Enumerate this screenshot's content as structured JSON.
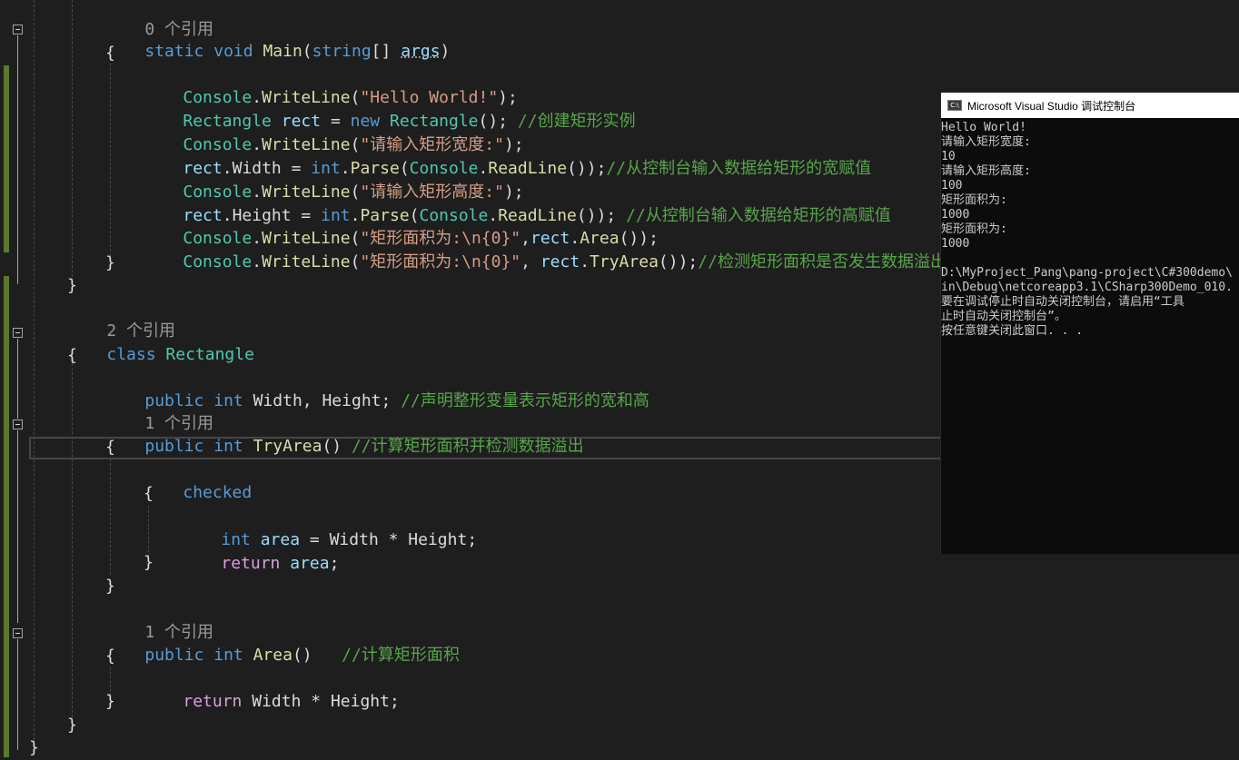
{
  "code": {
    "ref_0": "0 个引用",
    "static": "static",
    "void": "void",
    "main": "Main",
    "string": "string",
    "args": "args",
    "console": "Console",
    "writeline": "WriteLine",
    "readline": "ReadLine",
    "rectangle": "Rectangle",
    "rect": "rect",
    "new": "new",
    "int": "int",
    "parse": "Parse",
    "width": "Width",
    "height": "Height",
    "area": "Area",
    "tryarea": "TryArea",
    "str_hello": "\"Hello World!\"",
    "cmt_create": "//创建矩形实例",
    "str_input_width": "\"请输入矩形宽度:\"",
    "cmt_width": "//从控制台输入数据给矩形的宽赋值",
    "str_input_height": "\"请输入矩形高度:\"",
    "cmt_height": "//从控制台输入数据给矩形的高赋值",
    "str_area": "\"矩形面积为:\\n{0}\"",
    "cmt_check": "//检测矩形面积是否发生数据溢出",
    "ref_2": "2 个引用",
    "class": "class",
    "public": "public",
    "cmt_fields": "//声明整形变量表示矩形的宽和高",
    "ref_1": "1 个引用",
    "cmt_tryarea": "//计算矩形面积并检测数据溢出",
    "checked": "checked",
    "area_var": "area",
    "return": "return",
    "cmt_area": "//计算矩形面积"
  },
  "console_window": {
    "title": "Microsoft Visual Studio 调试控制台",
    "icon": "console-app-icon",
    "lines": [
      "Hello World!",
      "请输入矩形宽度:",
      "10",
      "请输入矩形高度:",
      "100",
      "矩形面积为:",
      "1000",
      "矩形面积为:",
      "1000",
      "",
      "D:\\MyProject_Pang\\pang-project\\C#300demo\\",
      "in\\Debug\\netcoreapp3.1\\CSharp300Demo_010.",
      "要在调试停止时自动关闭控制台，请启用“工具",
      "止时自动关闭控制台”。",
      "按任意键关闭此窗口. . ."
    ]
  },
  "colors": {
    "background": "#1e1e1e",
    "keyword": "#569cd6",
    "type": "#4ec9b0",
    "method": "#dcdcaa",
    "string": "#d69d85",
    "comment": "#57a64a",
    "control": "#d8a0df"
  }
}
